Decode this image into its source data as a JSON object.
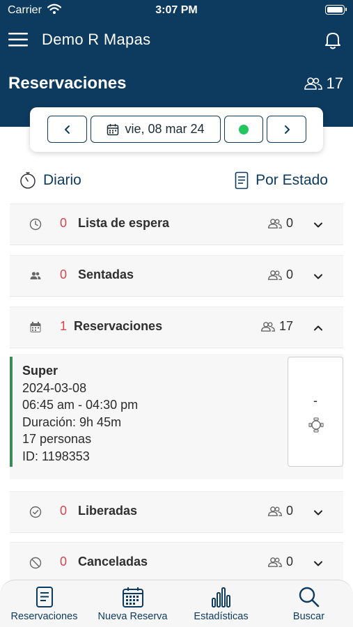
{
  "status_bar": {
    "carrier": "Carrier",
    "time": "3:07 PM"
  },
  "header": {
    "app_title": "Demo R Mapas",
    "page_title": "Reservaciones",
    "total_people": "17"
  },
  "date_nav": {
    "date_label": "vie, 08 mar 24"
  },
  "view": {
    "mode_daily": "Diario",
    "mode_status": "Por Estado"
  },
  "sections": [
    {
      "label": "Lista de espera",
      "count": "0",
      "people": "0",
      "icon": "clock-icon",
      "expanded": false
    },
    {
      "label": "Sentadas",
      "count": "0",
      "people": "0",
      "icon": "users-icon",
      "expanded": false
    },
    {
      "label": "Reservaciones",
      "count": "1",
      "people": "17",
      "icon": "calendar-icon",
      "expanded": true
    },
    {
      "label": "Liberadas",
      "count": "0",
      "people": "0",
      "icon": "check-circle-icon",
      "expanded": false
    },
    {
      "label": "Canceladas",
      "count": "0",
      "people": "0",
      "icon": "ban-icon",
      "expanded": false
    }
  ],
  "reservation": {
    "name": "Super",
    "date": "2024-03-08",
    "time_range": "06:45 am - 04:30 pm",
    "duration": "Duración: 9h 45m",
    "people": "17 personas",
    "id": "ID: 1198353",
    "table": "-"
  },
  "tabs": [
    {
      "label": "Reservaciones",
      "icon": "document-icon"
    },
    {
      "label": "Nueva Reserva",
      "icon": "calendar-grid-icon"
    },
    {
      "label": "Estadísticas",
      "icon": "bar-chart-icon"
    },
    {
      "label": "Buscar",
      "icon": "search-icon"
    }
  ],
  "colors": {
    "primary": "#0d3a5f",
    "count_red": "#d9434e",
    "active_green": "#22c55e",
    "card_bar": "#3d8a58"
  }
}
